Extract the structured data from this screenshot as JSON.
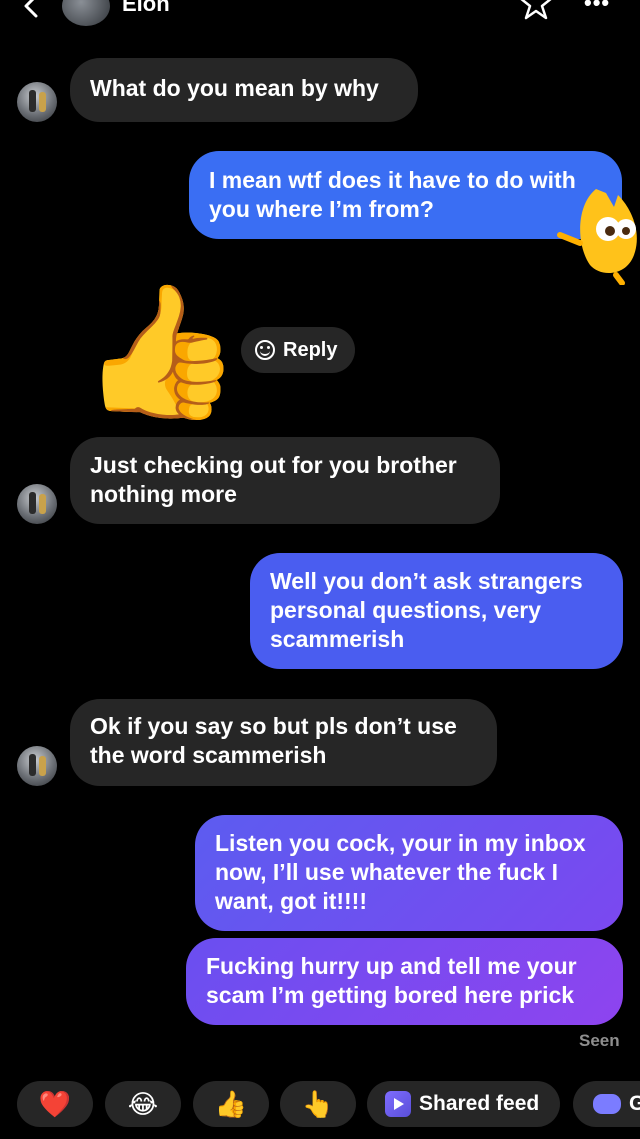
{
  "header": {
    "contact_name": "Elon",
    "more_label": "•••"
  },
  "messages": [
    {
      "id": "m1",
      "direction": "incoming",
      "text": "What do you mean by why"
    },
    {
      "id": "m2",
      "direction": "outgoing",
      "text": "I mean wtf does it have to do with you where I’m from?"
    },
    {
      "id": "m3",
      "direction": "incoming",
      "text": "Just checking out for you brother nothing more"
    },
    {
      "id": "m4",
      "direction": "outgoing",
      "text": "Well you don’t ask strangers personal questions, very scammerish"
    },
    {
      "id": "m5",
      "direction": "incoming",
      "text": "Ok if you say so but pls don’t use the word scammerish"
    },
    {
      "id": "m6",
      "direction": "outgoing",
      "text": "Listen you cock, your in my inbox now, I’ll use whatever the fuck I want, got it!!!!"
    },
    {
      "id": "m7",
      "direction": "outgoing",
      "text": "Fucking hurry up and tell me your scam I’m getting bored here prick"
    }
  ],
  "reaction_emoji": "👍",
  "reply_label": "Reply",
  "seen_label": "Seen",
  "quick_reactions": [
    "❤️",
    "😂",
    "👍",
    "👆"
  ],
  "chips": {
    "shared_feed_label": "Shared feed",
    "games_label": "G"
  },
  "colors": {
    "background": "#000000",
    "incoming_bubble": "#262626",
    "outgoing_bubble_start": "#3a6ef3",
    "outgoing_bubble_end": "#8e44ef",
    "seen_text": "#8e8e8e"
  }
}
